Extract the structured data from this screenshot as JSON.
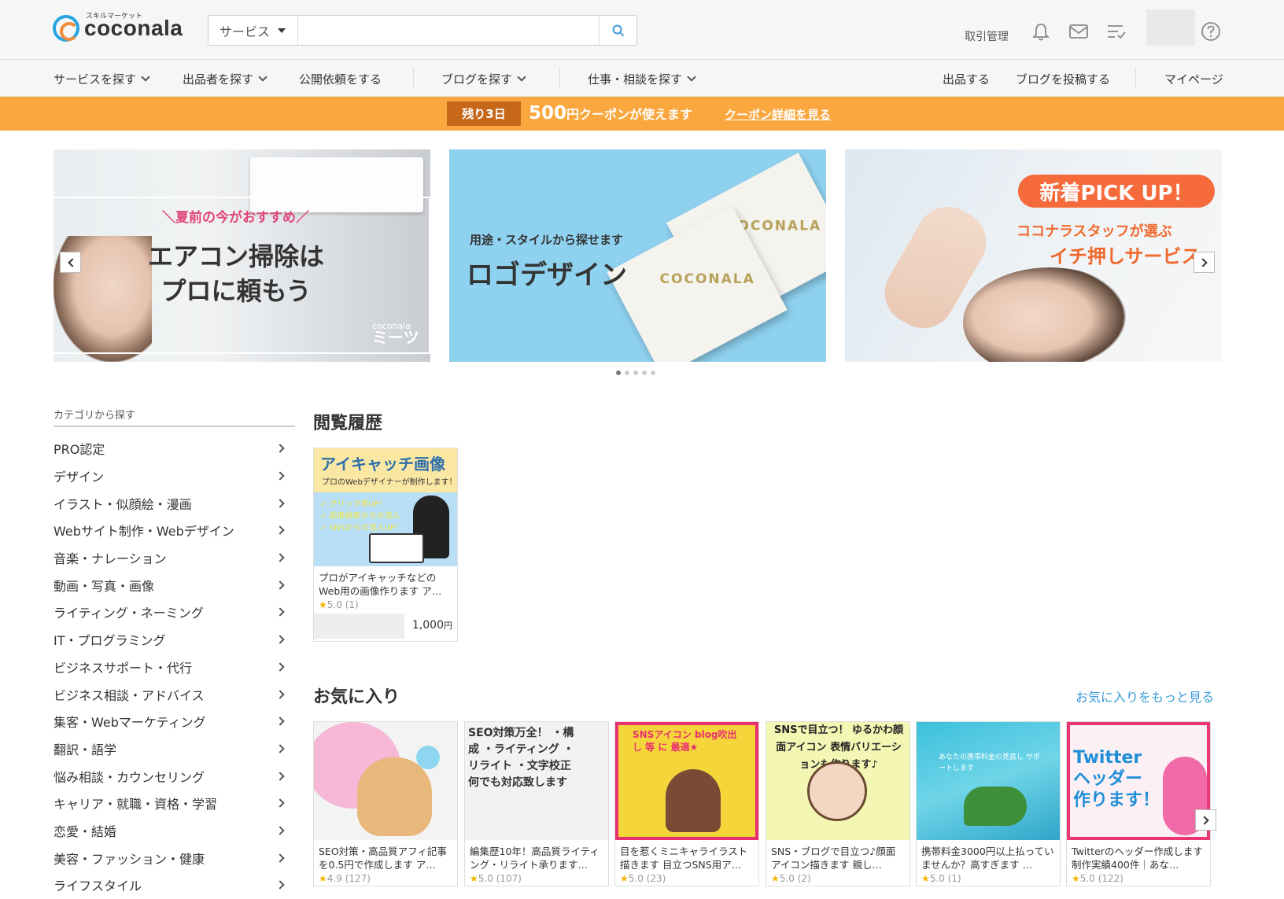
{
  "header": {
    "logo_sub": "スキルマーケット",
    "logo_name": "coconala",
    "search_category": "サービス",
    "search_placeholder": "",
    "trade_label": "取引管理"
  },
  "nav": {
    "items": [
      "サービスを探す",
      "出品者を探す",
      "公開依頼をする",
      "ブログを探す",
      "仕事・相談を探す"
    ],
    "right": [
      "出品する",
      "ブログを投稿する",
      "マイページ"
    ]
  },
  "coupon": {
    "days": "残り3日",
    "amount": "500",
    "text": "円クーポンが使えます",
    "link": "クーポン詳細を見る"
  },
  "banners": {
    "b1_tag": "＼夏前の今がおすすめ／",
    "b1_line1": "エアコン掃除は",
    "b1_line2": "プロに頼もう",
    "b1_logo_small": "coconala",
    "b1_logo_big": "ミーツ",
    "b2_sub": "用途・スタイルから探せます",
    "b2_title": "ロゴデザイン",
    "b2_card_logo": "COCONALA",
    "b3_pill": "新着PICK UP！",
    "b3_line1": "ココナラスタッフが選ぶ",
    "b3_line2": "イチ押しサービス"
  },
  "sidebar": {
    "heading": "カテゴリから探す",
    "categories": [
      "PRO認定",
      "デザイン",
      "イラスト・似顔絵・漫画",
      "Webサイト制作・Webデザイン",
      "音楽・ナレーション",
      "動画・写真・画像",
      "ライティング・ネーミング",
      "IT・プログラミング",
      "ビジネスサポート・代行",
      "ビジネス相談・アドバイス",
      "集客・Webマーケティング",
      "翻訳・語学",
      "悩み相談・カウンセリング",
      "キャリア・就職・資格・学習",
      "恋愛・結婚",
      "美容・ファッション・健康",
      "ライフスタイル"
    ]
  },
  "history": {
    "title": "閲覧履歴",
    "card": {
      "thumb_title": "アイキャッチ画像",
      "thumb_sub": "プロのWebデザイナーが制作します！",
      "thumb_list": [
        "✓ クリック率UP！",
        "✓ 画像検索からの流入",
        "✓ SNSからの流入UP！"
      ],
      "desc": "プロがアイキャッチなどのWeb用の画像作ります ア…",
      "rating": "5.0",
      "count": "(1)",
      "price": "1,000",
      "yen": "円"
    }
  },
  "favorites": {
    "title": "お気に入り",
    "more": "お気に入りをもっと見る",
    "cards": [
      {
        "desc": "SEO対策・高品質アフィ記事を0.5円で作成します ア…",
        "rating": "4.9",
        "count": "(127)",
        "thumb": ""
      },
      {
        "desc": "編集歴10年！高品質ライティング・リライト承ります…",
        "rating": "5.0",
        "count": "(107)",
        "thumb": "SEO対策万全！ ・構成 ・ライティング ・リライト ・文字校正 何でも対応致します"
      },
      {
        "desc": "目を惹くミニキャライラスト描きます 目立つSNS用ア…",
        "rating": "5.0",
        "count": "(23)",
        "thumb": "SNSアイコン blog吹出し 等 に 最適★"
      },
      {
        "desc": "SNS・ブログで目立つ♪顔面アイコン描きます 親し…",
        "rating": "5.0",
        "count": "(2)",
        "thumb": "SNSで目立つ！ ゆるかわ顔面アイコン 表情バリエーションも作ります♪"
      },
      {
        "desc": "携帯料金3000円以上払っていませんか？高すぎます …",
        "rating": "5.0",
        "count": "(1)",
        "thumb": "あなたの携帯料金の見直し サポートします"
      },
      {
        "desc": "Twitterのヘッダー作成します 制作実績400件｜あな…",
        "rating": "5.0",
        "count": "(122)",
        "thumb": "Twitter ヘッダー 作ります！"
      }
    ]
  },
  "colors": {
    "accent": "#f9a73e",
    "link": "#3c9bd8",
    "star": "#f5b400"
  }
}
